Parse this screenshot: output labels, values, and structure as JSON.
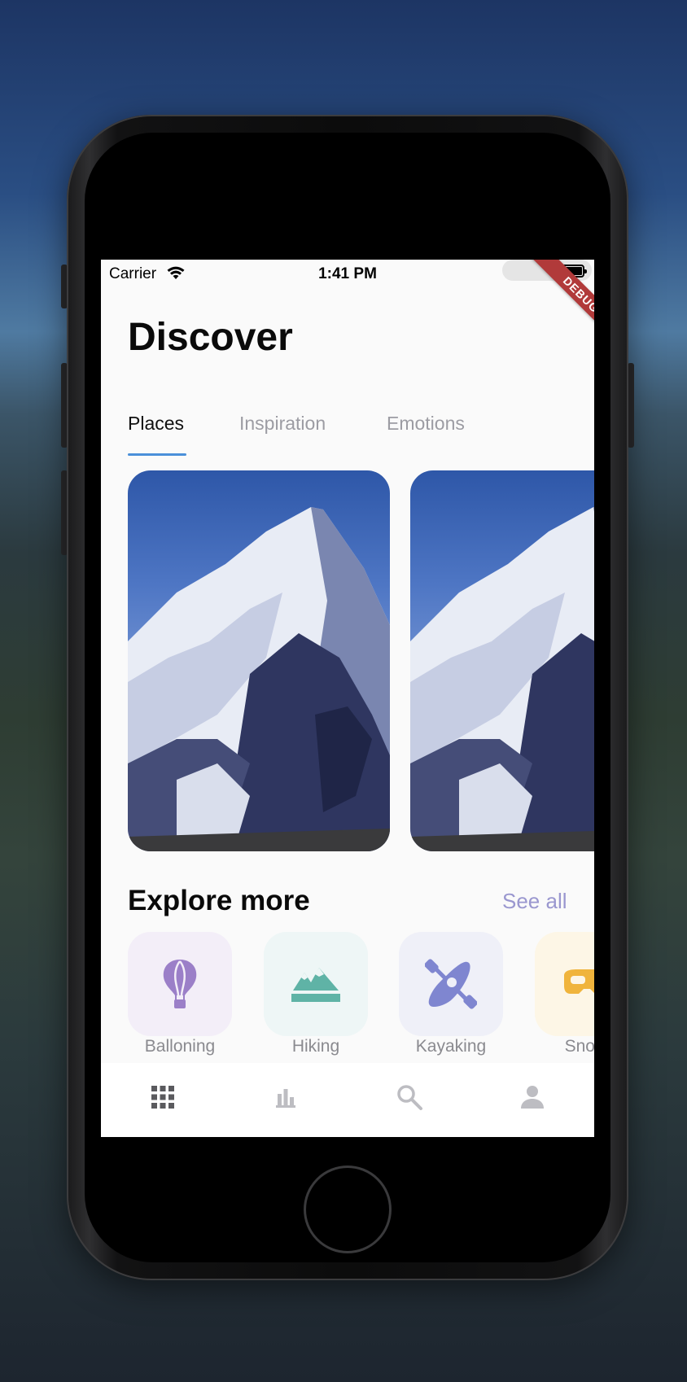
{
  "status_bar": {
    "carrier": "Carrier",
    "time": "1:41 PM"
  },
  "debug_banner": "DEBUG",
  "header": {
    "title": "Discover"
  },
  "tabs": [
    {
      "label": "Places",
      "active": true
    },
    {
      "label": "Inspiration",
      "active": false
    },
    {
      "label": "Emotions",
      "active": false
    }
  ],
  "cards": [
    {
      "image": "mountain-peak-photo"
    },
    {
      "image": "mountain-peak-photo"
    }
  ],
  "explore": {
    "title": "Explore more",
    "see_all_label": "See all",
    "items": [
      {
        "label": "Balloning",
        "icon": "hot-air-balloon-icon",
        "color": "#9b7fc8",
        "bg": "#f3eef8"
      },
      {
        "label": "Hiking",
        "icon": "mountains-icon",
        "color": "#5fb3a6",
        "bg": "#eef6f6"
      },
      {
        "label": "Kayaking",
        "icon": "kayak-icon",
        "color": "#7f86d0",
        "bg": "#eff0f8"
      },
      {
        "label": "Snork",
        "icon": "snorkel-mask-icon",
        "color": "#f0b43c",
        "bg": "#fdf6e6"
      }
    ]
  },
  "bottom_nav": [
    {
      "name": "grid-icon",
      "active": true
    },
    {
      "name": "stats-icon",
      "active": false
    },
    {
      "name": "search-icon",
      "active": false
    },
    {
      "name": "profile-icon",
      "active": false
    }
  ],
  "colors": {
    "accent": "#4a90d9",
    "see_all": "#9a97cf",
    "debug": "#b13a3a"
  }
}
